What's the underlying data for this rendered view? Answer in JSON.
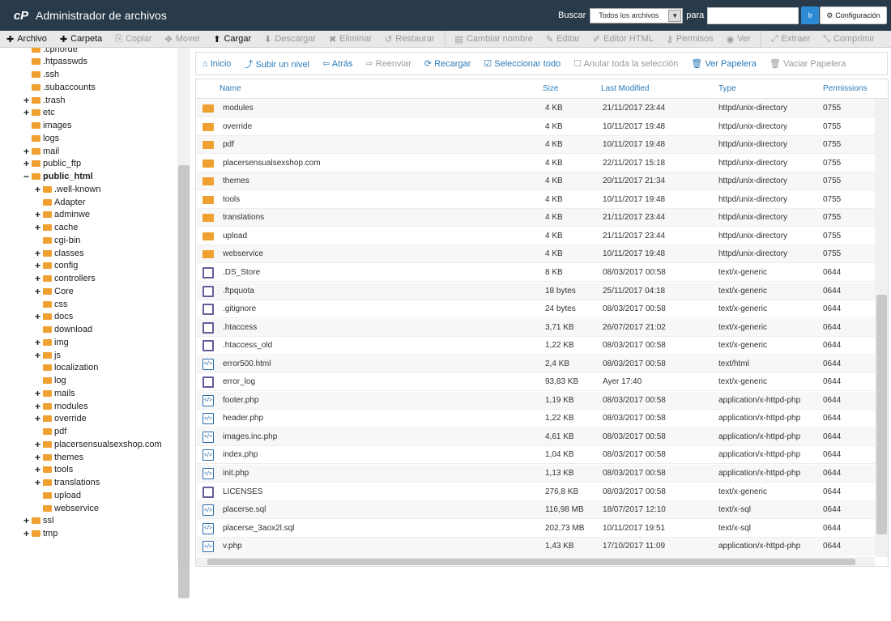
{
  "header": {
    "title": "Administrador de archivos",
    "search_label": "Buscar",
    "search_scope": "Todos los archivos",
    "para_label": "para",
    "search_placeholder": "",
    "go_label": "Ir",
    "config_label": "Configuración"
  },
  "toolbar": [
    {
      "icon": "plus-icon",
      "label": "Archivo",
      "active": true
    },
    {
      "icon": "plus-icon",
      "label": "Carpeta",
      "active": true
    },
    {
      "icon": "copy-icon",
      "label": "Copiar",
      "active": false
    },
    {
      "icon": "move-icon",
      "label": "Mover",
      "active": false
    },
    {
      "icon": "upload-icon",
      "label": "Cargar",
      "active": true
    },
    {
      "icon": "download-icon",
      "label": "Descargar",
      "active": false
    },
    {
      "icon": "delete-icon",
      "label": "Eliminar",
      "active": false
    },
    {
      "icon": "restore-icon",
      "label": "Restaurar",
      "active": false
    },
    {
      "icon": "rename-icon",
      "label": "Cambiar nombre",
      "active": false
    },
    {
      "icon": "edit-icon",
      "label": "Editar",
      "active": false
    },
    {
      "icon": "html-editor-icon",
      "label": "Editor HTML",
      "active": false
    },
    {
      "icon": "key-icon",
      "label": "Permisos",
      "active": false
    },
    {
      "icon": "eye-icon",
      "label": "Ver",
      "active": false
    },
    {
      "icon": "extract-icon",
      "label": "Extraer",
      "active": false
    },
    {
      "icon": "compress-icon",
      "label": "Comprimir",
      "active": false
    }
  ],
  "tree": [
    {
      "label": ".cpnorde",
      "level": 2,
      "exp": ""
    },
    {
      "label": ".htpasswds",
      "level": 2,
      "exp": ""
    },
    {
      "label": ".ssh",
      "level": 2,
      "exp": ""
    },
    {
      "label": ".subaccounts",
      "level": 2,
      "exp": ""
    },
    {
      "label": ".trash",
      "level": 2,
      "exp": "+"
    },
    {
      "label": "etc",
      "level": 2,
      "exp": "+"
    },
    {
      "label": "images",
      "level": 2,
      "exp": ""
    },
    {
      "label": "logs",
      "level": 2,
      "exp": ""
    },
    {
      "label": "mail",
      "level": 2,
      "exp": "+"
    },
    {
      "label": "public_ftp",
      "level": 2,
      "exp": "+"
    },
    {
      "label": "public_html",
      "level": 2,
      "exp": "−",
      "bold": true
    },
    {
      "label": ".well-known",
      "level": 3,
      "exp": "+"
    },
    {
      "label": "Adapter",
      "level": 3,
      "exp": ""
    },
    {
      "label": "adminwe",
      "level": 3,
      "exp": "+"
    },
    {
      "label": "cache",
      "level": 3,
      "exp": "+"
    },
    {
      "label": "cgi-bin",
      "level": 3,
      "exp": ""
    },
    {
      "label": "classes",
      "level": 3,
      "exp": "+"
    },
    {
      "label": "config",
      "level": 3,
      "exp": "+"
    },
    {
      "label": "controllers",
      "level": 3,
      "exp": "+"
    },
    {
      "label": "Core",
      "level": 3,
      "exp": "+"
    },
    {
      "label": "css",
      "level": 3,
      "exp": ""
    },
    {
      "label": "docs",
      "level": 3,
      "exp": "+"
    },
    {
      "label": "download",
      "level": 3,
      "exp": ""
    },
    {
      "label": "img",
      "level": 3,
      "exp": "+"
    },
    {
      "label": "js",
      "level": 3,
      "exp": "+"
    },
    {
      "label": "localization",
      "level": 3,
      "exp": ""
    },
    {
      "label": "log",
      "level": 3,
      "exp": ""
    },
    {
      "label": "mails",
      "level": 3,
      "exp": "+"
    },
    {
      "label": "modules",
      "level": 3,
      "exp": "+"
    },
    {
      "label": "override",
      "level": 3,
      "exp": "+"
    },
    {
      "label": "pdf",
      "level": 3,
      "exp": ""
    },
    {
      "label": "placersensualsexshop.com",
      "level": 3,
      "exp": "+"
    },
    {
      "label": "themes",
      "level": 3,
      "exp": "+"
    },
    {
      "label": "tools",
      "level": 3,
      "exp": "+"
    },
    {
      "label": "translations",
      "level": 3,
      "exp": "+"
    },
    {
      "label": "upload",
      "level": 3,
      "exp": ""
    },
    {
      "label": "webservice",
      "level": 3,
      "exp": ""
    },
    {
      "label": "ssl",
      "level": 2,
      "exp": "+"
    },
    {
      "label": "tmp",
      "level": 2,
      "exp": "+"
    }
  ],
  "actions": [
    {
      "icon": "home-icon",
      "label": "Inicio",
      "enabled": true
    },
    {
      "icon": "level-up-icon",
      "label": "Subir un nivel",
      "enabled": true
    },
    {
      "icon": "back-icon",
      "label": "Atrás",
      "enabled": true
    },
    {
      "icon": "forward-icon",
      "label": "Reenviar",
      "enabled": false
    },
    {
      "icon": "reload-icon",
      "label": "Recargar",
      "enabled": true
    },
    {
      "icon": "check-all-icon",
      "label": "Seleccionar todo",
      "enabled": true
    },
    {
      "icon": "uncheck-icon",
      "label": "Anular toda la selección",
      "enabled": false
    },
    {
      "icon": "trash-icon",
      "label": "Ver Papelera",
      "enabled": true
    },
    {
      "icon": "trash-empty-icon",
      "label": "Vaciar Papelera",
      "enabled": false
    }
  ],
  "table": {
    "columns": {
      "name": "Name",
      "size": "Size",
      "modified": "Last Modified",
      "type": "Type",
      "permissions": "Permissions"
    },
    "rows": [
      {
        "icon": "folder",
        "name": "modules",
        "size": "4 KB",
        "modified": "21/11/2017 23:44",
        "type": "httpd/unix-directory",
        "perm": "0755"
      },
      {
        "icon": "folder",
        "name": "override",
        "size": "4 KB",
        "modified": "10/11/2017 19:48",
        "type": "httpd/unix-directory",
        "perm": "0755"
      },
      {
        "icon": "folder",
        "name": "pdf",
        "size": "4 KB",
        "modified": "10/11/2017 19:48",
        "type": "httpd/unix-directory",
        "perm": "0755"
      },
      {
        "icon": "folder",
        "name": "placersensualsexshop.com",
        "size": "4 KB",
        "modified": "22/11/2017 15:18",
        "type": "httpd/unix-directory",
        "perm": "0755"
      },
      {
        "icon": "folder",
        "name": "themes",
        "size": "4 KB",
        "modified": "20/11/2017 21:34",
        "type": "httpd/unix-directory",
        "perm": "0755"
      },
      {
        "icon": "folder",
        "name": "tools",
        "size": "4 KB",
        "modified": "10/11/2017 19:48",
        "type": "httpd/unix-directory",
        "perm": "0755"
      },
      {
        "icon": "folder",
        "name": "translations",
        "size": "4 KB",
        "modified": "21/11/2017 23:44",
        "type": "httpd/unix-directory",
        "perm": "0755"
      },
      {
        "icon": "folder",
        "name": "upload",
        "size": "4 KB",
        "modified": "21/11/2017 23:44",
        "type": "httpd/unix-directory",
        "perm": "0755"
      },
      {
        "icon": "folder",
        "name": "webservice",
        "size": "4 KB",
        "modified": "10/11/2017 19:48",
        "type": "httpd/unix-directory",
        "perm": "0755"
      },
      {
        "icon": "file",
        "name": ".DS_Store",
        "size": "8 KB",
        "modified": "08/03/2017 00:58",
        "type": "text/x-generic",
        "perm": "0644"
      },
      {
        "icon": "file",
        "name": ".ftpquota",
        "size": "18 bytes",
        "modified": "25/11/2017 04:18",
        "type": "text/x-generic",
        "perm": "0644"
      },
      {
        "icon": "file",
        "name": ".gitignore",
        "size": "24 bytes",
        "modified": "08/03/2017 00:58",
        "type": "text/x-generic",
        "perm": "0644"
      },
      {
        "icon": "file",
        "name": ".htaccess",
        "size": "3,71 KB",
        "modified": "26/07/2017 21:02",
        "type": "text/x-generic",
        "perm": "0644"
      },
      {
        "icon": "file",
        "name": ".htaccess_old",
        "size": "1,22 KB",
        "modified": "08/03/2017 00:58",
        "type": "text/x-generic",
        "perm": "0644"
      },
      {
        "icon": "code",
        "name": "error500.html",
        "size": "2,4 KB",
        "modified": "08/03/2017 00:58",
        "type": "text/html",
        "perm": "0644"
      },
      {
        "icon": "file",
        "name": "error_log",
        "size": "93,83 KB",
        "modified": "Ayer 17:40",
        "type": "text/x-generic",
        "perm": "0644"
      },
      {
        "icon": "code",
        "name": "footer.php",
        "size": "1,19 KB",
        "modified": "08/03/2017 00:58",
        "type": "application/x-httpd-php",
        "perm": "0644"
      },
      {
        "icon": "code",
        "name": "header.php",
        "size": "1,22 KB",
        "modified": "08/03/2017 00:58",
        "type": "application/x-httpd-php",
        "perm": "0644"
      },
      {
        "icon": "code",
        "name": "images.inc.php",
        "size": "4,61 KB",
        "modified": "08/03/2017 00:58",
        "type": "application/x-httpd-php",
        "perm": "0644"
      },
      {
        "icon": "code",
        "name": "index.php",
        "size": "1,04 KB",
        "modified": "08/03/2017 00:58",
        "type": "application/x-httpd-php",
        "perm": "0644"
      },
      {
        "icon": "code",
        "name": "init.php",
        "size": "1,13 KB",
        "modified": "08/03/2017 00:58",
        "type": "application/x-httpd-php",
        "perm": "0644"
      },
      {
        "icon": "file",
        "name": "LICENSES",
        "size": "276,8 KB",
        "modified": "08/03/2017 00:58",
        "type": "text/x-generic",
        "perm": "0644"
      },
      {
        "icon": "code",
        "name": "placerse.sql",
        "size": "116,98 MB",
        "modified": "18/07/2017 12:10",
        "type": "text/x-sql",
        "perm": "0644"
      },
      {
        "icon": "code",
        "name": "placerse_3aox2l.sql",
        "size": "202,73 MB",
        "modified": "10/11/2017 19:51",
        "type": "text/x-sql",
        "perm": "0644"
      },
      {
        "icon": "code",
        "name": "v.php",
        "size": "1,43 KB",
        "modified": "17/10/2017 11:09",
        "type": "application/x-httpd-php",
        "perm": "0644"
      }
    ]
  }
}
